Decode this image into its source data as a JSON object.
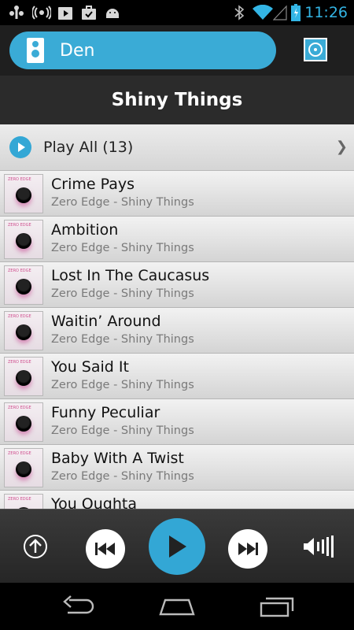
{
  "status": {
    "time": "11:26",
    "icons": [
      "usb-icon",
      "radio-icon",
      "play-store-icon",
      "briefcase-icon",
      "android-icon",
      "bluetooth-icon",
      "wifi-icon",
      "signal-icon",
      "battery-icon"
    ]
  },
  "header": {
    "room": "Den",
    "room_icon": "speaker-icon",
    "now_playing_icon": "now-playing-icon"
  },
  "album": {
    "title": "Shiny Things"
  },
  "play_all": {
    "label": "Play All (13)"
  },
  "tracks": [
    {
      "title": "Crime Pays",
      "subtitle": "Zero Edge - Shiny Things"
    },
    {
      "title": "Ambition",
      "subtitle": "Zero Edge - Shiny Things"
    },
    {
      "title": "Lost In The Caucasus",
      "subtitle": "Zero Edge - Shiny Things"
    },
    {
      "title": "Waitin’ Around",
      "subtitle": "Zero Edge - Shiny Things"
    },
    {
      "title": "You Said It",
      "subtitle": "Zero Edge - Shiny Things"
    },
    {
      "title": "Funny Peculiar",
      "subtitle": "Zero Edge - Shiny Things"
    },
    {
      "title": "Baby With A Twist",
      "subtitle": "Zero Edge - Shiny Things"
    },
    {
      "title": "You Oughta",
      "subtitle": ""
    }
  ],
  "art_label": "ZERO EDGE",
  "transport": {
    "buttons": [
      "upload-icon",
      "previous-icon",
      "play-icon",
      "next-icon",
      "volume-icon"
    ]
  },
  "navbar": {
    "buttons": [
      "back-icon",
      "home-icon",
      "recents-icon"
    ]
  },
  "colors": {
    "accent": "#33a7d5",
    "room_button": "#3aabd6",
    "clock": "#33b5e5"
  }
}
